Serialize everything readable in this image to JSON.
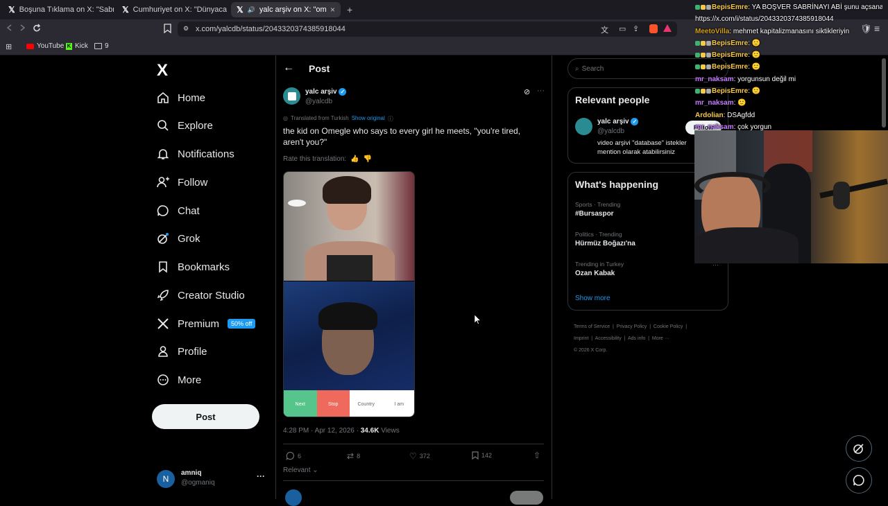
{
  "browser": {
    "tabs": [
      {
        "title": "Boşuna Tıklama on X: \"Sabrina Carpe",
        "active": false
      },
      {
        "title": "Cumhuriyet on X: \"Dünyaca ünlü şarl",
        "active": false
      },
      {
        "title": "yalc arşiv on X: \"omeglede he",
        "active": true
      }
    ],
    "tab_close": "×",
    "new_tab": "+",
    "url": "x.com/yalcdb/status/2043320374385918044",
    "bookmarks": [
      {
        "label": "YouTube"
      },
      {
        "label": "Kick"
      },
      {
        "label": "9"
      }
    ]
  },
  "nav": {
    "logo": "X",
    "items": [
      {
        "label": "Home",
        "icon": "home-icon"
      },
      {
        "label": "Explore",
        "icon": "search-icon"
      },
      {
        "label": "Notifications",
        "icon": "bell-icon"
      },
      {
        "label": "Follow",
        "icon": "add-person-icon"
      },
      {
        "label": "Chat",
        "icon": "chat-icon"
      },
      {
        "label": "Grok",
        "icon": "grok-icon"
      },
      {
        "label": "Bookmarks",
        "icon": "bookmark-icon"
      },
      {
        "label": "Creator Studio",
        "icon": "rocket-icon"
      },
      {
        "label": "Premium",
        "icon": "x-icon"
      },
      {
        "label": "Profile",
        "icon": "person-icon"
      },
      {
        "label": "More",
        "icon": "more-circle-icon"
      }
    ],
    "premium_badge": "50% off",
    "post_button": "Post",
    "account": {
      "avatar_letter": "N",
      "name": "amniq",
      "handle": "@ogmaniq",
      "more": "···"
    }
  },
  "post": {
    "header": "Post",
    "author_name": "yalc arşiv",
    "author_handle": "@yalcdb",
    "translated_from": "Translated from Turkish",
    "show_original": "Show original",
    "text": "the kid on Omegle who says to every girl he meets, \"you're tired, aren't you?\"",
    "rate_translation": "Rate this translation:",
    "media_buttons": [
      "Next",
      "Stop",
      "Country",
      "I am"
    ],
    "timestamp": "4:28 PM · Apr 12, 2026 · ",
    "views_count": "34.6K",
    "views_label": " Views",
    "actions": {
      "replies": "6",
      "reposts": "8",
      "likes": "372",
      "bookmarks": "142"
    },
    "sort": "Relevant"
  },
  "right": {
    "search_placeholder": "Search",
    "relevant_title": "Relevant people",
    "person": {
      "name": "yalc arşiv",
      "handle": "@yalcdb",
      "bio": "video arşivi \"database\" istekler mention olarak atabilirsiniz",
      "follow": "Follow"
    },
    "happening_title": "What's happening",
    "trends": [
      {
        "context": "Sports · Trending",
        "name": "#Bursaspor"
      },
      {
        "context": "Politics · Trending",
        "name": "Hürmüz Boğazı'na"
      },
      {
        "context": "Trending in Turkey",
        "name": "Ozan Kabak"
      }
    ],
    "trend_more": "···",
    "show_more": "Show more",
    "footer": [
      "Terms of Service",
      "Privacy Policy",
      "Cookie Policy",
      "Imprint",
      "Accessibility",
      "Ads info",
      "More ···"
    ],
    "copyright": "© 2026 X Corp."
  },
  "chat": [
    {
      "user": "BepisEmre",
      "msg": "YA BOŞVER SABRİNAYI ABİ şunu açsana",
      "color": "#f7c948",
      "badges": true
    },
    {
      "user": "",
      "msg": "https://x.com/i/status/2043320374385918044",
      "color": "#fff",
      "badges": false
    },
    {
      "user": "MeetoVilla",
      "msg": "mehmet kapitalizmanasını siktikleriyin",
      "color": "#d4a017",
      "badges": false
    },
    {
      "user": "BepisEmre",
      "msg": "🙂",
      "color": "#f7c948",
      "badges": true
    },
    {
      "user": "BepisEmre",
      "msg": "🙂",
      "color": "#f7c948",
      "badges": true
    },
    {
      "user": "BepisEmre",
      "msg": "🙂",
      "color": "#f7c948",
      "badges": true
    },
    {
      "user": "mr_naksam",
      "msg": "yorgunsun değil mi",
      "color": "#c77dff",
      "badges": false
    },
    {
      "user": "BepisEmre",
      "msg": "🙂",
      "color": "#f7c948",
      "badges": true
    },
    {
      "user": "mr_naksam",
      "msg": "🙂",
      "color": "#c77dff",
      "badges": false
    },
    {
      "user": "Ardolian",
      "msg": "DSAgfdd",
      "color": "#f7c948",
      "badges": false
    },
    {
      "user": "mr_naksam",
      "msg": "çok yorgun",
      "color": "#c77dff",
      "badges": false
    }
  ]
}
